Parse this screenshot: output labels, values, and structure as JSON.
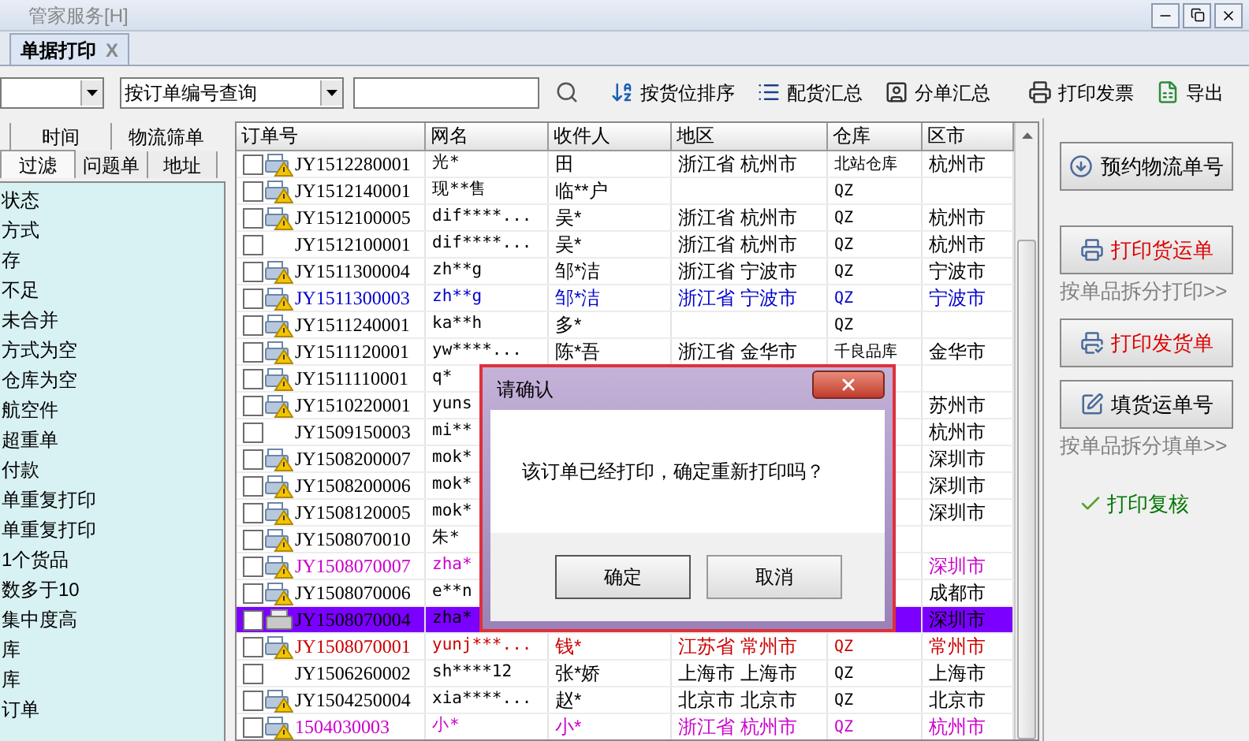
{
  "window": {
    "title": "管家服务[H]"
  },
  "tabs": [
    {
      "label": "单据打印",
      "close": "X",
      "selected": true
    }
  ],
  "toolbar": {
    "search_mode": {
      "value": "按订单编号查询"
    },
    "buttons": [
      {
        "label": "按货位排序"
      },
      {
        "label": "配货汇总"
      },
      {
        "label": "分单汇总"
      },
      {
        "label": "打印发票"
      },
      {
        "label": "导出"
      }
    ]
  },
  "filter_tabs": {
    "row_1": [
      {
        "label": "时间",
        "selected": false
      },
      {
        "label": "物流筛单",
        "selected": false
      }
    ],
    "row_2": [
      {
        "label": "过滤",
        "selected": true
      },
      {
        "label": "问题单",
        "selected": false
      },
      {
        "label": "地址",
        "selected": false
      }
    ]
  },
  "filter_list": [
    "状态",
    "方式",
    "存",
    "不足",
    "未合并",
    "方式为空",
    "仓库为空",
    "航空件",
    "超重单",
    "付款",
    "单重复打印",
    "单重复打印",
    "1个货品",
    "数多于10",
    "集中度高",
    "库",
    "库",
    "订单"
  ],
  "table": {
    "columns": [
      "订单号",
      "网名",
      "收件人",
      "地区",
      "仓库",
      "区市"
    ],
    "rows": [
      {
        "cells": [
          "JY1512280001",
          "光*",
          "田",
          "浙江省 杭州市",
          "北站仓库",
          "杭州市"
        ],
        "kind": "warning",
        "color": "#000000",
        "checked": false,
        "selected": false
      },
      {
        "cells": [
          "JY1512140001",
          "现**售",
          "临**户",
          "",
          "QZ",
          ""
        ],
        "kind": "warning",
        "color": "#000000",
        "checked": false,
        "selected": false
      },
      {
        "cells": [
          "JY1512100005",
          "dif****...",
          "吴*",
          "浙江省 杭州市",
          "QZ",
          "杭州市"
        ],
        "kind": "warning",
        "color": "#000000",
        "checked": false,
        "selected": false
      },
      {
        "cells": [
          "JY1512100001",
          "dif****...",
          "吴*",
          "浙江省 杭州市",
          "QZ",
          "杭州市"
        ],
        "kind": "none",
        "color": "#000000",
        "checked": false,
        "selected": false
      },
      {
        "cells": [
          "JY1511300004",
          "zh**g",
          "邹*洁",
          "浙江省 宁波市",
          "QZ",
          "宁波市"
        ],
        "kind": "warning",
        "color": "#000000",
        "checked": false,
        "selected": false
      },
      {
        "cells": [
          "JY1511300003",
          "zh**g",
          "邹*洁",
          "浙江省 宁波市",
          "QZ",
          "宁波市"
        ],
        "kind": "warning",
        "color": "#0000cc",
        "checked": false,
        "selected": false
      },
      {
        "cells": [
          "JY1511240001",
          "ka**h",
          "多*",
          "",
          "QZ",
          ""
        ],
        "kind": "warning",
        "color": "#000000",
        "checked": false,
        "selected": false
      },
      {
        "cells": [
          "JY1511120001",
          "yw****...",
          "陈*吾",
          "浙江省 金华市",
          "千良品库",
          "金华市"
        ],
        "kind": "warning",
        "color": "#000000",
        "checked": false,
        "selected": false
      },
      {
        "cells": [
          "JY1511110001",
          "q*",
          "",
          "",
          "",
          ""
        ],
        "kind": "warning",
        "color": "#000000",
        "checked": false,
        "selected": false
      },
      {
        "cells": [
          "JY1510220001",
          "yuns",
          "",
          "",
          "",
          "苏州市"
        ],
        "kind": "warning",
        "color": "#000000",
        "checked": false,
        "selected": false
      },
      {
        "cells": [
          "JY1509150003",
          "mi**",
          "",
          "",
          "",
          "杭州市"
        ],
        "kind": "none",
        "color": "#000000",
        "checked": false,
        "selected": false
      },
      {
        "cells": [
          "JY1508200007",
          "mok*",
          "",
          "",
          "",
          "深圳市"
        ],
        "kind": "warning",
        "color": "#000000",
        "checked": false,
        "selected": false
      },
      {
        "cells": [
          "JY1508200006",
          "mok*",
          "",
          "",
          "",
          "深圳市"
        ],
        "kind": "warning",
        "color": "#000000",
        "checked": false,
        "selected": false
      },
      {
        "cells": [
          "JY1508120005",
          "mok*",
          "",
          "",
          "",
          "深圳市"
        ],
        "kind": "warning",
        "color": "#000000",
        "checked": false,
        "selected": false
      },
      {
        "cells": [
          "JY1508070010",
          "朱*",
          "",
          "",
          "",
          ""
        ],
        "kind": "warning",
        "color": "#000000",
        "checked": false,
        "selected": false
      },
      {
        "cells": [
          "JY1508070007",
          "zha*",
          "",
          "",
          "",
          "深圳市"
        ],
        "kind": "warning",
        "color": "#cc00cc",
        "checked": false,
        "selected": false
      },
      {
        "cells": [
          "JY1508070006",
          "e**n",
          "",
          "",
          "",
          "成都市"
        ],
        "kind": "warning",
        "color": "#000000",
        "checked": false,
        "selected": false
      },
      {
        "cells": [
          "JY1508070004",
          "zha*",
          "",
          "",
          "",
          "深圳市"
        ],
        "kind": "printed",
        "checked": false,
        "selected": true
      },
      {
        "cells": [
          "JY1508070001",
          "yunj***...",
          "钱*",
          "江苏省 常州市",
          "QZ",
          "常州市"
        ],
        "kind": "warning",
        "color": "#cc0000",
        "checked": false,
        "selected": false
      },
      {
        "cells": [
          "JY1506260002",
          "sh****12",
          "张*娇",
          "上海市 上海市",
          "QZ",
          "上海市"
        ],
        "kind": "none",
        "color": "#000000",
        "checked": false,
        "selected": false
      },
      {
        "cells": [
          "JY1504250004",
          "xia****...",
          "赵*",
          "北京市 北京市",
          "QZ",
          "北京市"
        ],
        "kind": "warning",
        "color": "#000000",
        "checked": false,
        "selected": false
      },
      {
        "cells": [
          "1504030003",
          "小*",
          "小*",
          "浙江省 杭州市",
          "QZ",
          "杭州市"
        ],
        "kind": "warning",
        "color": "#cc00cc",
        "checked": false,
        "selected": false
      }
    ]
  },
  "side_actions": [
    {
      "kind": "button",
      "label": "预约物流单号",
      "color": "#000000"
    },
    {
      "kind": "button",
      "label": "打印货运单",
      "color": "#dd0000"
    },
    {
      "kind": "link",
      "label": "按单品拆分打印>>",
      "color": "#808080"
    },
    {
      "kind": "button",
      "label": "打印发货单",
      "color": "#dd0000"
    },
    {
      "kind": "button",
      "label": "填货运单号",
      "color": "#000000"
    },
    {
      "kind": "link",
      "label": "按单品拆分填单>>",
      "color": "#808080"
    },
    {
      "kind": "check",
      "label": "打印复核",
      "color": "#007700"
    }
  ],
  "dialog": {
    "title": "请确认",
    "message": "该订单已经打印，确定重新打印吗？",
    "buttons": [
      "确定",
      "取消"
    ]
  }
}
